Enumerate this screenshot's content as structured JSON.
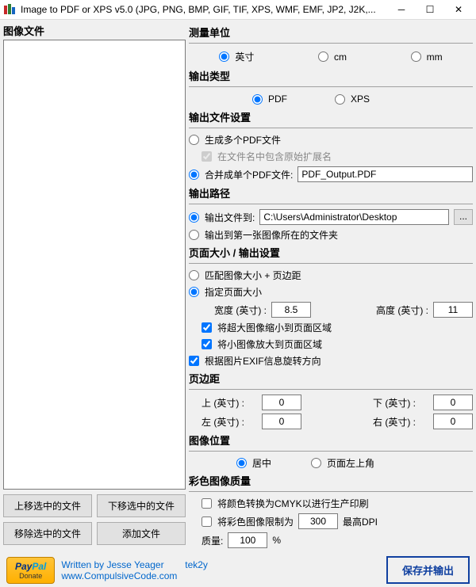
{
  "window": {
    "title": "Image to PDF or XPS  v5.0   (JPG, PNG, BMP, GIF, TIF, XPS, WMF, EMF, JP2, J2K,..."
  },
  "left": {
    "title": "图像文件",
    "btn_up": "上移选中的文件",
    "btn_down": "下移选中的文件",
    "btn_remove": "移除选中的文件",
    "btn_add": "添加文件"
  },
  "unit": {
    "title": "测量单位",
    "inch": "英寸",
    "cm": "cm",
    "mm": "mm",
    "selected": "inch"
  },
  "out_type": {
    "title": "输出类型",
    "pdf": "PDF",
    "xps": "XPS",
    "selected": "pdf"
  },
  "out_file": {
    "title": "输出文件设置",
    "multi": "生成多个PDF文件",
    "multi_sub": "在文件名中包含原始扩展名",
    "merge": "合并成单个PDF文件:",
    "filename": "PDF_Output.PDF",
    "selected": "merge"
  },
  "out_path": {
    "title": "输出路径",
    "to": "输出文件到:",
    "path": "C:\\Users\\Administrator\\Desktop",
    "first_img": "输出到第一张图像所在的文件夹",
    "selected": "to"
  },
  "page_size": {
    "title": "页面大小 / 输出设置",
    "match": "匹配图像大小 + 页边距",
    "specify": "指定页面大小",
    "width_lbl": "宽度 (英寸) :",
    "width": "8.5",
    "height_lbl": "高度 (英寸) :",
    "height": "11",
    "shrink": "将超大图像缩小到页面区域",
    "enlarge": "将小图像放大到页面区域",
    "exif": "根据图片EXIF信息旋转方向",
    "selected": "specify"
  },
  "margins": {
    "title": "页边距",
    "top_lbl": "上 (英寸) :",
    "top": "0",
    "bottom_lbl": "下 (英寸) :",
    "bottom": "0",
    "left_lbl": "左 (英寸) :",
    "left": "0",
    "right_lbl": "右 (英寸) :",
    "right": "0"
  },
  "img_pos": {
    "title": "图像位置",
    "center": "居中",
    "topleft": "页面左上角",
    "selected": "center"
  },
  "color": {
    "title": "彩色图像质量",
    "cmyk": "将颜色转换为CMYK以进行生产印刷",
    "limit": "将彩色图像限制为",
    "dpi": "300",
    "dpi_lbl": "最高DPI",
    "quality_lbl": "质量:",
    "quality": "100",
    "pct": "%"
  },
  "footer": {
    "by": "Written by Jesse Yeager",
    "name": "tek2y",
    "site": "www.CompulsiveCode.com",
    "save": "保存并输出"
  }
}
